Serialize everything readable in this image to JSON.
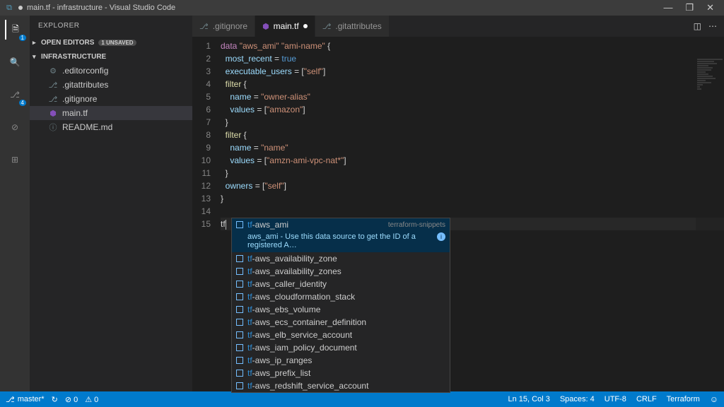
{
  "title": "main.tf - infrastructure - Visual Studio Code",
  "explorerTitle": "EXPLORER",
  "sections": {
    "openEditors": "OPEN EDITORS",
    "openEditorsTag": "1 UNSAVED",
    "folder": "INFRASTRUCTURE"
  },
  "files": [
    {
      "name": ".editorconfig",
      "icon": "⚙",
      "tf": false
    },
    {
      "name": ".gitattributes",
      "icon": "⎇",
      "tf": false
    },
    {
      "name": ".gitignore",
      "icon": "⎇",
      "tf": false
    },
    {
      "name": "main.tf",
      "icon": "⬢",
      "tf": true,
      "active": true
    },
    {
      "name": "README.md",
      "icon": "ⓘ",
      "tf": false
    }
  ],
  "tabs": [
    {
      "label": ".gitignore",
      "icon": "⎇",
      "tf": false,
      "active": false,
      "dirty": false
    },
    {
      "label": "main.tf",
      "icon": "⬢",
      "tf": true,
      "active": true,
      "dirty": true
    },
    {
      "label": ".gitattributes",
      "icon": "⎇",
      "tf": false,
      "active": false,
      "dirty": false
    }
  ],
  "code": {
    "lines": [
      {
        "n": 1,
        "html": "<span class='kw'>data</span> <span class='str'>\"aws_ami\"</span> <span class='str'>\"ami-name\"</span> {"
      },
      {
        "n": 2,
        "html": "  <span class='prop'>most_recent</span> = <span class='bool'>true</span>"
      },
      {
        "n": 3,
        "html": "  <span class='prop'>executable_users</span> = [<span class='str'>\"self\"</span>]"
      },
      {
        "n": 4,
        "html": "  <span class='fn'>filter</span> {"
      },
      {
        "n": 5,
        "html": "    <span class='prop'>name</span> = <span class='str'>\"owner-alias\"</span>"
      },
      {
        "n": 6,
        "html": "    <span class='prop'>values</span> = [<span class='str'>\"amazon\"</span>]"
      },
      {
        "n": 7,
        "html": "  }"
      },
      {
        "n": 8,
        "html": "  <span class='fn'>filter</span> {"
      },
      {
        "n": 9,
        "html": "    <span class='prop'>name</span> = <span class='str'>\"name\"</span>"
      },
      {
        "n": 10,
        "html": "    <span class='prop'>values</span> = [<span class='str'>\"amzn-ami-vpc-nat*\"</span>]"
      },
      {
        "n": 11,
        "html": "  }"
      },
      {
        "n": 12,
        "html": "  <span class='prop'>owners</span> = [<span class='str'>\"self\"</span>]"
      },
      {
        "n": 13,
        "html": "}"
      },
      {
        "n": 14,
        "html": ""
      },
      {
        "n": 15,
        "html": "<span class='typed'>tf</span><span class='cursor-ln'></span>",
        "cur": true
      }
    ]
  },
  "suggest": {
    "source": "terraform-snippets",
    "items": [
      {
        "prefix": "tf",
        "rest": "-aws_ami",
        "sel": true
      },
      {
        "prefix": "tf",
        "rest": "-aws_availability_zone"
      },
      {
        "prefix": "tf",
        "rest": "-aws_availability_zones"
      },
      {
        "prefix": "tf",
        "rest": "-aws_caller_identity"
      },
      {
        "prefix": "tf",
        "rest": "-aws_cloudformation_stack"
      },
      {
        "prefix": "tf",
        "rest": "-aws_ebs_volume"
      },
      {
        "prefix": "tf",
        "rest": "-aws_ecs_container_definition"
      },
      {
        "prefix": "tf",
        "rest": "-aws_elb_service_account"
      },
      {
        "prefix": "tf",
        "rest": "-aws_iam_policy_document"
      },
      {
        "prefix": "tf",
        "rest": "-aws_ip_ranges"
      },
      {
        "prefix": "tf",
        "rest": "-aws_prefix_list"
      },
      {
        "prefix": "tf",
        "rest": "-aws_redshift_service_account"
      }
    ],
    "detail": "aws_ami - Use this data source to get the ID of a registered A…"
  },
  "status": {
    "branch": "master*",
    "sync": "↻",
    "errors": "⊘ 0",
    "warnings": "⚠ 0",
    "pos": "Ln 15, Col 3",
    "spaces": "Spaces: 4",
    "enc": "UTF-8",
    "eol": "CRLF",
    "lang": "Terraform"
  },
  "activityBadges": {
    "files": "1",
    "git": "4"
  }
}
